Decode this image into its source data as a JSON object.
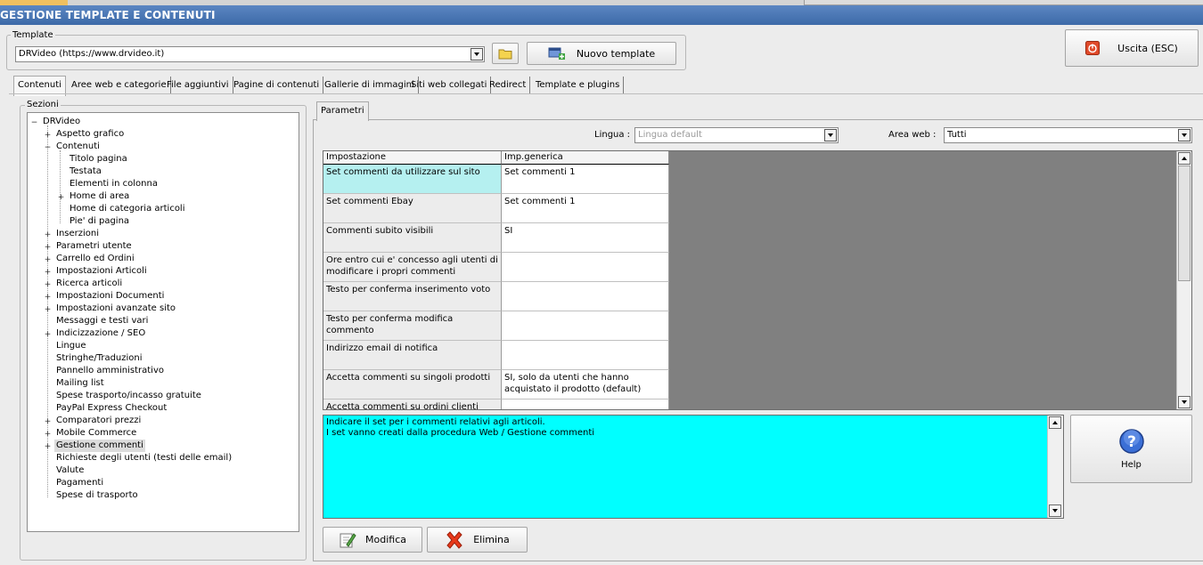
{
  "window": {
    "title": "GESTIONE TEMPLATE E CONTENUTI"
  },
  "template_group": {
    "label": "Template",
    "selected": "DRVideo (https://www.drvideo.it)",
    "new_button": "Nuovo template"
  },
  "exit_button": "Uscita (ESC)",
  "tabs": [
    "Contenuti",
    "Aree web e categorie",
    "File aggiuntivi",
    "Pagine di contenuti",
    "Gallerie di immagini",
    "Siti web collegati",
    "Redirect",
    "Template e plugins"
  ],
  "sections": {
    "label": "Sezioni",
    "root": "DRVideo",
    "items": [
      "Aspetto grafico",
      "Contenuti",
      "Titolo pagina",
      "Testata",
      "Elementi in colonna",
      "Home di area",
      "Home di categoria articoli",
      "Pie' di pagina",
      "Inserzioni",
      "Parametri utente",
      "Carrello ed Ordini",
      "Impostazioni Articoli",
      "Ricerca articoli",
      "Impostazioni Documenti",
      "Impostazioni avanzate sito",
      "Messaggi e testi vari",
      "Indicizzazione / SEO",
      "Lingue",
      "Stringhe/Traduzioni",
      "Pannello amministrativo",
      "Mailing list",
      "Spese trasporto/incasso gratuite",
      "PayPal Express Checkout",
      "Comparatori prezzi",
      "Mobile Commerce",
      "Gestione commenti",
      "Richieste degli utenti (testi delle email)",
      "Valute",
      "Pagamenti",
      "Spese di trasporto"
    ]
  },
  "params_tab": "Parametri",
  "filters": {
    "lingua_label": "Lingua :",
    "lingua_value": "Lingua default",
    "area_label": "Area web :",
    "area_value": "Tutti"
  },
  "grid": {
    "headers": [
      "Impostazione",
      "Imp.generica"
    ],
    "rows": [
      [
        "Set commenti da utilizzare sul sito",
        "Set commenti 1"
      ],
      [
        "Set commenti Ebay",
        "Set commenti 1"
      ],
      [
        "Commenti subito visibili",
        "SI"
      ],
      [
        "Ore entro cui e' concesso agli utenti di modificare i propri commenti",
        ""
      ],
      [
        "Testo per conferma inserimento voto",
        ""
      ],
      [
        "Testo per conferma modifica commento",
        ""
      ],
      [
        "Indirizzo email di notifica",
        ""
      ],
      [
        "Accetta commenti su singoli prodotti",
        "SI, solo da utenti che hanno acquistato il prodotto (default)"
      ],
      [
        "Accetta commenti su ordini clienti EVASI",
        ""
      ]
    ]
  },
  "description": {
    "line1": "Indicare il set per i commenti relativi agli articoli.",
    "line2": "I set vanno creati dalla procedura Web / Gestione commenti"
  },
  "help_button": "Help",
  "buttons": {
    "modifica": "Modifica",
    "elimina": "Elimina"
  },
  "colors": {
    "title_bar": "#3d6aa8",
    "description_bg": "#00ffff",
    "selected_cell": "#b5f0f0",
    "grid_empty": "#808080"
  }
}
